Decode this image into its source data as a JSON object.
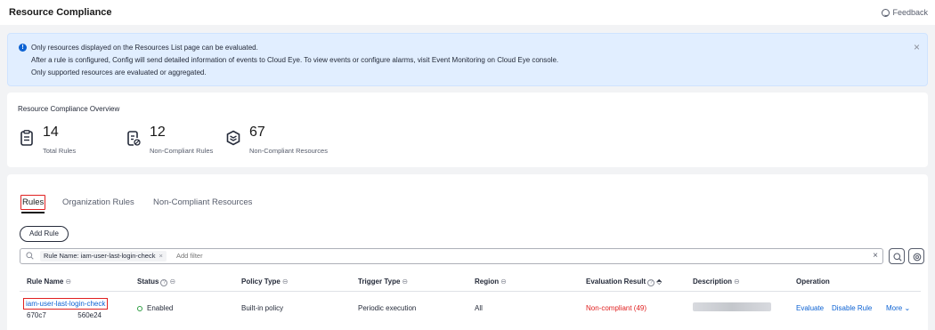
{
  "header": {
    "title": "Resource Compliance",
    "feedback": "Feedback"
  },
  "notice": {
    "lines": [
      "Only resources displayed on the Resources List page can be evaluated.",
      "After a rule is configured, Config will send detailed information of events to Cloud Eye. To view events or configure alarms, visit Event Monitoring on Cloud Eye console.",
      "Only supported resources are evaluated or aggregated."
    ],
    "close": "×"
  },
  "overview": {
    "title": "Resource Compliance Overview",
    "stats": [
      {
        "value": "14",
        "label": "Total Rules",
        "icon": "rules-document-icon"
      },
      {
        "value": "12",
        "label": "Non-Compliant Rules",
        "icon": "non-compliant-rules-icon"
      },
      {
        "value": "67",
        "label": "Non-Compliant Resources",
        "icon": "layers-resources-icon"
      }
    ]
  },
  "tabs": [
    "Rules",
    "Organization Rules",
    "Non-Compliant Resources"
  ],
  "toolbar": {
    "add_rule": "Add Rule"
  },
  "filter": {
    "chip": "Rule Name: iam-user-last-login-check",
    "chip_close": "×",
    "placeholder": "Add filter",
    "clear": "×"
  },
  "table": {
    "headers": {
      "rule_name": "Rule Name",
      "status": "Status",
      "policy_type": "Policy Type",
      "trigger_type": "Trigger Type",
      "region": "Region",
      "evaluation_result": "Evaluation Result",
      "description": "Description",
      "operation": "Operation"
    },
    "rows": [
      {
        "rule_name": "iam-user-last-login-check",
        "id_prefix": "670c7",
        "id_suffix": "560e24",
        "status": "Enabled",
        "policy_type": "Built-in policy",
        "trigger_type": "Periodic execution",
        "region": "All",
        "evaluation_result": "Non-compliant (49)",
        "ops": {
          "evaluate": "Evaluate",
          "disable": "Disable Rule",
          "more": "More ⌄"
        }
      }
    ]
  },
  "colors": {
    "link": "#0c62d3",
    "danger": "#e02020",
    "success": "#2e9e43",
    "notice_bg": "#e1eeff"
  }
}
